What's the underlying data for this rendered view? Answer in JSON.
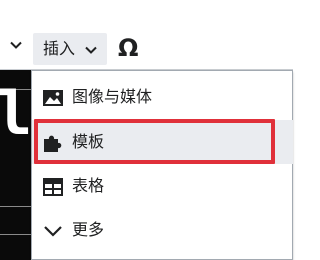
{
  "toolbar": {
    "insert_label": "插入",
    "special_char_label": "Ω"
  },
  "page": {
    "background_text": "lc"
  },
  "insert_menu": {
    "items": [
      {
        "label": "图像与媒体",
        "icon": "image-icon"
      },
      {
        "label": "模板",
        "icon": "puzzle-icon",
        "highlighted": true
      },
      {
        "label": "表格",
        "icon": "table-icon"
      },
      {
        "label": "更多",
        "icon": "chevron-down-icon"
      }
    ]
  },
  "colors": {
    "highlight_border": "#e0303a",
    "hover_background": "#eaecf0",
    "text": "#202122"
  }
}
